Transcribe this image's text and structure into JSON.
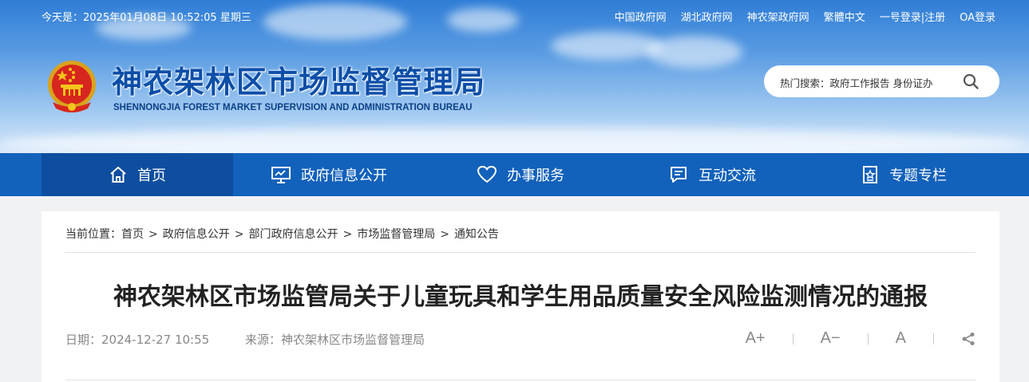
{
  "topbar": {
    "datetime": "今天是：2025年01月08日 10:52:05 星期三",
    "links": [
      "中国政府网",
      "湖北政府网",
      "神农架政府网",
      "繁體中文",
      "一号登录|注册",
      "OA登录"
    ]
  },
  "header": {
    "title": "神农架林区市场监督管理局",
    "subtitle": "SHENNONGJIA FOREST MARKET SUPERVISION AND ADMINISTRATION BUREAU",
    "search_text": "热门搜索：政府工作报告 身份证办"
  },
  "nav": {
    "items": [
      {
        "label": "首页",
        "icon": "home-icon"
      },
      {
        "label": "政府信息公开",
        "icon": "presentation-board-icon"
      },
      {
        "label": "办事服务",
        "icon": "heart-icon"
      },
      {
        "label": "互动交流",
        "icon": "chat-icon"
      },
      {
        "label": "专题专栏",
        "icon": "star-document-icon"
      }
    ],
    "active_index": 0
  },
  "breadcrumb": {
    "prefix": "当前位置：",
    "items": [
      "首页",
      "政府信息公开",
      "部门政府信息公开",
      "市场监督管理局",
      "通知公告"
    ],
    "separator": ">"
  },
  "article": {
    "title": "神农架林区市场监管局关于儿童玩具和学生用品质量安全风险监测情况的通报",
    "date": "日期：2024-12-27 10:55",
    "source": "来源：神农架林区市场监督管理局"
  },
  "tools": {
    "font_larger": "A+",
    "font_smaller": "A−",
    "font_default": "A",
    "share_icon": "share-icon"
  },
  "colors": {
    "nav_bg": "#1261bb",
    "nav_active_bg": "#0e4ea0",
    "title_blue": "#0c4ea8"
  }
}
